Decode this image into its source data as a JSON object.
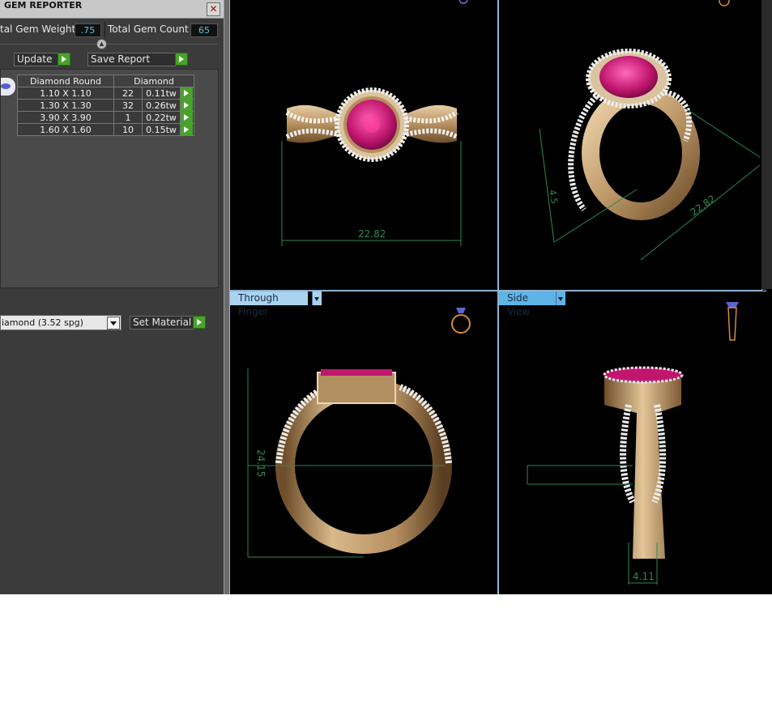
{
  "panel": {
    "title": "GEM REPORTER",
    "close_glyph": "✕",
    "total_gem_weight_label": "tal Gem Weight",
    "total_gem_weight_value": ".75",
    "total_gem_count_label": "Total Gem Count",
    "total_gem_count_value": "65",
    "update_label": "Update",
    "save_report_label": "Save Report",
    "table": {
      "headers": [
        "Diamond Round",
        "Diamond"
      ],
      "rows": [
        {
          "size": "1.10 X 1.10",
          "count": "22",
          "weight": "0.11tw"
        },
        {
          "size": "1.30 X 1.30",
          "count": "32",
          "weight": "0.26tw"
        },
        {
          "size": "3.90 X 3.90",
          "count": "1",
          "weight": "0.22tw"
        },
        {
          "size": "1.60 X 1.60",
          "count": "10",
          "weight": "0.15tw"
        }
      ]
    },
    "material_select": "iamond     (3.52 spg)",
    "set_material_label": "Set Material"
  },
  "viewports": {
    "top_left": {
      "dimension": "22.82"
    },
    "top_right": {
      "dimension_a": "22.82",
      "dimension_b": "4.5"
    },
    "bottom_left": {
      "label": "Through Finger",
      "dimension": "24.15"
    },
    "bottom_right": {
      "label": "Side View",
      "dimension": "4.11"
    }
  },
  "colors": {
    "gold": "#c9a77c",
    "ruby": "#c0166e",
    "dimension_line": "#2a8a52",
    "view_tab": "#a9d3ef",
    "view_tab_active": "#5fb4e6",
    "value_text": "#56c6e8"
  },
  "icons": [
    "close-icon",
    "play-arrow-icon",
    "dropdown-arrow-icon",
    "ring-orientation-icon"
  ]
}
